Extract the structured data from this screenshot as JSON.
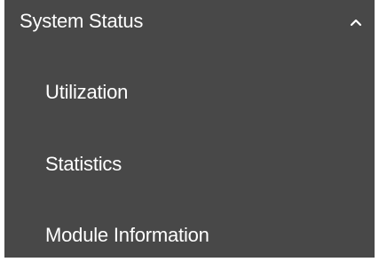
{
  "menu": {
    "title": "System Status",
    "expand_icon": "chevron-up-icon",
    "items": [
      {
        "label": "Utilization"
      },
      {
        "label": "Statistics"
      },
      {
        "label": "Module Information"
      }
    ]
  },
  "colors": {
    "background": "#484848",
    "text": "#ffffff"
  }
}
